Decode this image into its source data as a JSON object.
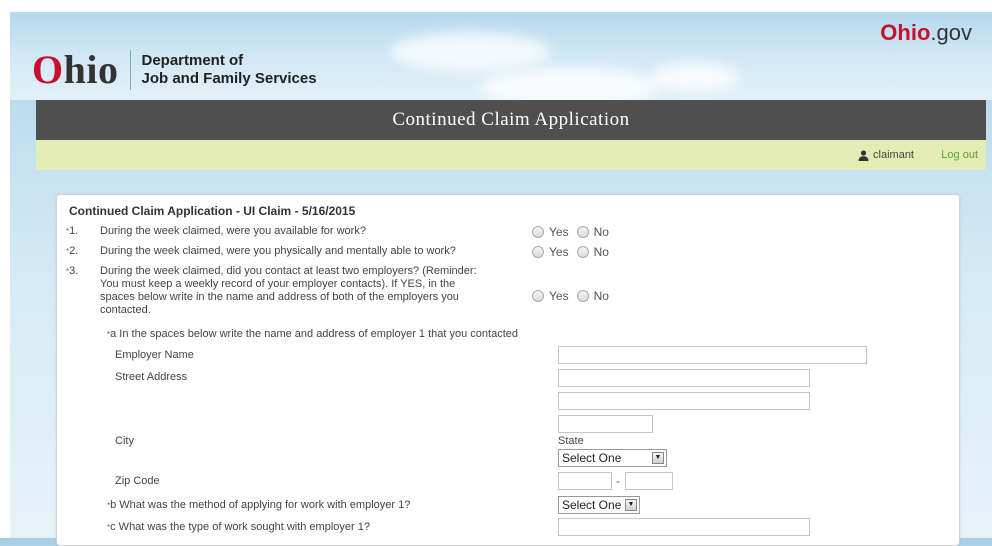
{
  "header": {
    "logo_o": "O",
    "logo_rest": "hio",
    "dept_line1": "Department of",
    "dept_line2": "Job and Family Services",
    "ohiogov_o": "O",
    "ohiogov_hio": "hio",
    "ohiogov_rest": ".gov"
  },
  "titlebar": {
    "title": "Continued Claim Application"
  },
  "userbar": {
    "username": "claimant",
    "logout": "Log out"
  },
  "form": {
    "title": "Continued Claim Application - UI Claim - 5/16/2015",
    "questions": [
      {
        "num": "1.",
        "text": "During the week claimed, were you available for work?"
      },
      {
        "num": "2.",
        "text": "During the week claimed, were you physically and mentally able to work?"
      },
      {
        "num": "3.",
        "text_l1": "During the week claimed, did you contact at least two employers? (Reminder:",
        "text_l2": "You must keep a weekly record of your employer contacts). If YES, in the",
        "text_l3": "spaces below write in the name and address of both of the employers you",
        "text_l4": "contacted."
      }
    ],
    "yes": "Yes",
    "no": "No",
    "sub_a": "a  In the spaces below write the name and address of employer 1 that you contacted",
    "employer_name": "Employer Name",
    "street_address": "Street Address",
    "city": "City",
    "state": "State",
    "state_select": "Select One",
    "zip": "Zip Code",
    "zip_sep": "-",
    "sub_b": "b   What was the method of applying for work with employer 1?",
    "method_select": "Select One",
    "sub_c": "c   What was the type of work sought with employer 1?"
  }
}
